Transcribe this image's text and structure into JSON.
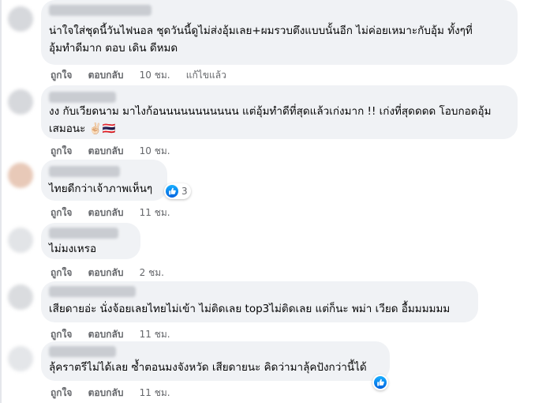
{
  "comments": [
    {
      "text_lines": [
        "น่าใจใส่ชุดนี้วันไฟนอล ชุดวันนี้ดูไม่ส่งอุ้มเลย+ผมรวบตึงแบบนั้นอีก ไม่ค่อยเหมาะกับอุ้ม ทั้งๆที่",
        "อุ้มทำดีมาก ตอบ เดิน ดีหมด"
      ],
      "like_label": "ถูกใจ",
      "reply_label": "ตอบกลับ",
      "time": "10 ชม.",
      "edited_label": "แก้ไขแล้ว"
    },
    {
      "text_lines": [
        "งง กับเวียดนาม มาไงก้อนนนนนนนนนนน แต่อุ้มทำดีที่สุดแล้วเก่งมาก !! เก่งที่สุดดดด โอบกอดอุ้ม",
        "เสมอนะ ✌🏻🇹🇭"
      ],
      "like_label": "ถูกใจ",
      "reply_label": "ตอบกลับ",
      "time": "10 ชม."
    },
    {
      "text_lines": [
        "ไทยดีกว่าเจ้าภาพเห็นๆ"
      ],
      "like_label": "ถูกใจ",
      "reply_label": "ตอบกลับ",
      "time": "11 ชม.",
      "reaction_count": "3"
    },
    {
      "text_lines": [
        "ไม่มงเหรอ"
      ],
      "like_label": "ถูกใจ",
      "reply_label": "ตอบกลับ",
      "time": "2 ชม."
    },
    {
      "text_lines": [
        "เสียดายอ่ะ นั่งจ้อยเลยไทยไม่เข้า ไม่ติดเลย top3ไม่ติดเลย แต่ก็นะ พม่า เวียด อื้มมมมมม"
      ],
      "like_label": "ถูกใจ",
      "reply_label": "ตอบกลับ",
      "time": "11 ชม."
    },
    {
      "text_lines": [
        "ลุ้คราตรีไม่ได้เลย ซ้ำตอนมงจังหวัด เสียดายนะ คิดว่ามาลุ้คปังกว่านี้ได้"
      ],
      "like_label": "ถูกใจ",
      "reply_label": "ตอบกลับ",
      "time": "11 ชม."
    }
  ],
  "colors": {
    "bubble": "#f0f2f5",
    "meta_text": "#65676b",
    "like_blue": "#1877f2"
  },
  "icons": [
    "like-icon"
  ]
}
